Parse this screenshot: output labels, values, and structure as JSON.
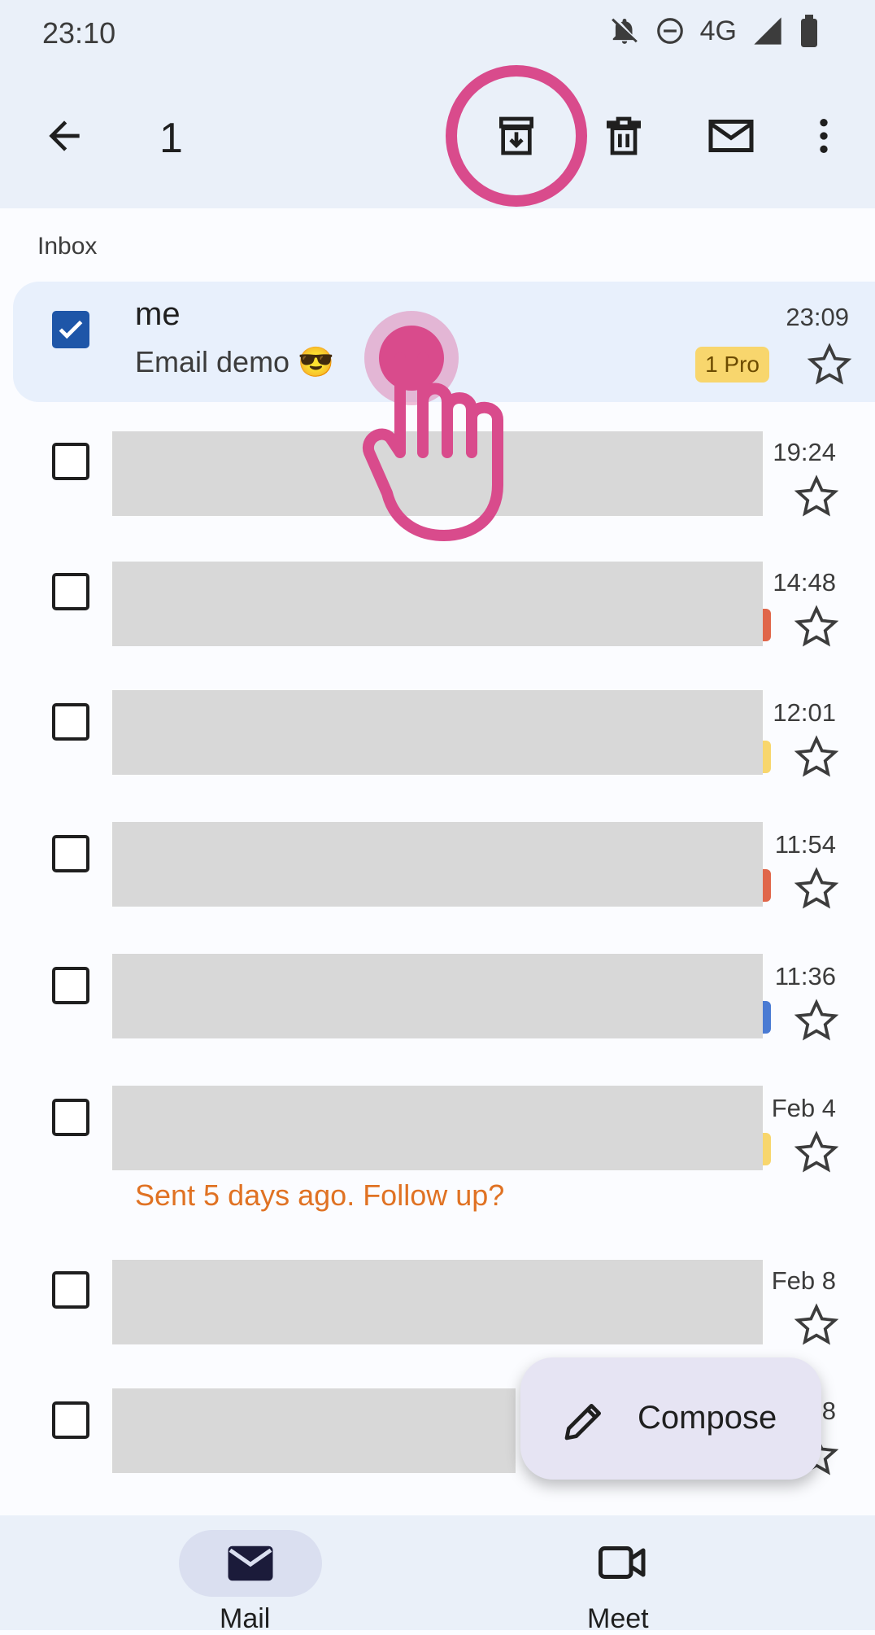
{
  "status_bar": {
    "time": "23:10",
    "network": "4G"
  },
  "toolbar": {
    "selected_count": "1"
  },
  "section": {
    "label": "Inbox"
  },
  "emails": [
    {
      "sender": "me",
      "subject": "Email demo 😎",
      "time": "23:09",
      "badge": "1 Pro",
      "selected": true
    },
    {
      "time": "19:24"
    },
    {
      "time": "14:48"
    },
    {
      "time": "12:01"
    },
    {
      "time": "11:54"
    },
    {
      "time": "11:36"
    },
    {
      "time": "Feb 4",
      "nudge": "Sent 5 days ago. Follow up?"
    },
    {
      "time": "Feb 8"
    },
    {
      "time": "8"
    }
  ],
  "fab": {
    "label": "Compose"
  },
  "bottom_nav": {
    "mail_label": "Mail",
    "meet_label": "Meet"
  },
  "colors": {
    "accent": "#1e56a8",
    "touch_overlay": "#d94b8c",
    "nudge": "#e07223"
  }
}
